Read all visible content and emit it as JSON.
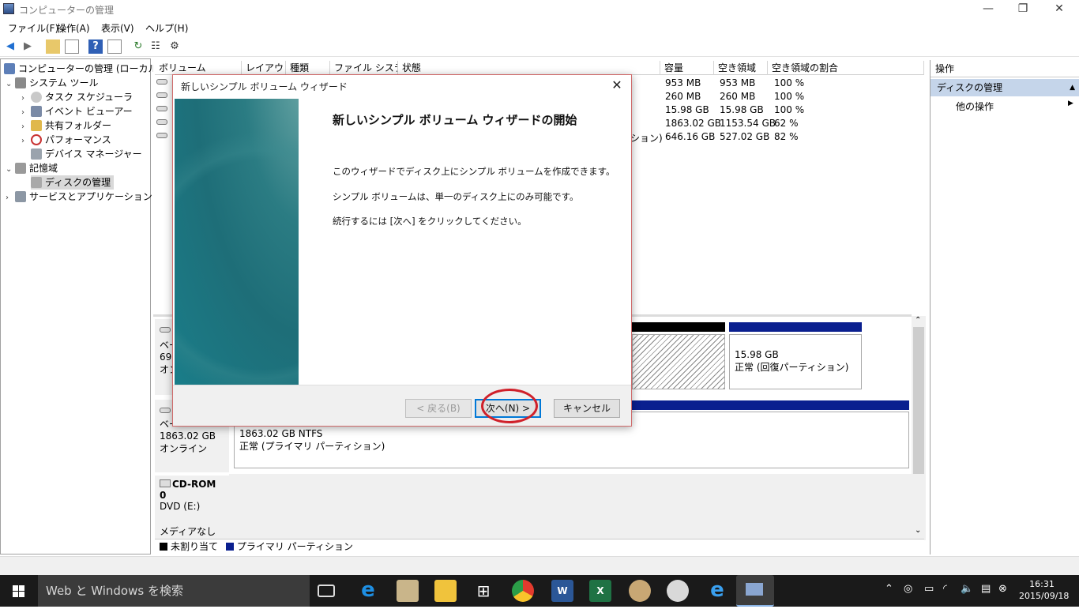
{
  "window": {
    "title": "コンピューターの管理"
  },
  "menu": [
    "ファイル(F)",
    "操作(A)",
    "表示(V)",
    "ヘルプ(H)"
  ],
  "tree": {
    "root": "コンピューターの管理 (ローカル)",
    "items": [
      {
        "label": "システム ツール"
      },
      {
        "label": "タスク スケジューラ"
      },
      {
        "label": "イベント ビューアー"
      },
      {
        "label": "共有フォルダー"
      },
      {
        "label": "パフォーマンス"
      },
      {
        "label": "デバイス マネージャー"
      },
      {
        "label": "記憶域"
      },
      {
        "label": "ディスクの管理"
      },
      {
        "label": "サービスとアプリケーション"
      }
    ]
  },
  "list": {
    "columns": [
      "ボリューム",
      "レイアウト",
      "種類",
      "ファイル システム",
      "状態",
      "容量",
      "空き領域",
      "空き領域の割合"
    ],
    "rows": [
      {
        "cap": "953 MB",
        "free": "953 MB",
        "pct": "100 %"
      },
      {
        "cap": "260 MB",
        "free": "260 MB",
        "pct": "100 %"
      },
      {
        "cap": "15.98 GB",
        "free": "15.98 GB",
        "pct": "100 %"
      },
      {
        "cap": "1863.02 GB",
        "free": "1153.54 GB",
        "pct": "62 %"
      },
      {
        "cap": "646.16 GB",
        "free": "527.02 GB",
        "pct": "82 %",
        "status_tail": "ション)"
      }
    ]
  },
  "graph": {
    "disk0_label_lines": [
      "ベー",
      "698",
      "オン"
    ],
    "disk1": {
      "label": "ベー",
      "size": "1863.02 GB",
      "state": "オンライン",
      "part_size": "1863.02 GB NTFS",
      "part_state": "正常 (プライマリ パーティション)"
    },
    "recovery": {
      "size": "15.98 GB",
      "state": "正常 (回復パーティション)"
    },
    "cdrom": {
      "name": "CD-ROM 0",
      "drive": "DVD (E:)",
      "media": "メディアなし"
    }
  },
  "legend": {
    "unallocated": "未割り当て",
    "primary": "プライマリ パーティション"
  },
  "actions": {
    "header": "操作",
    "section": "ディスクの管理",
    "item": "他の操作"
  },
  "dialog": {
    "title": "新しいシンプル ボリューム ウィザード",
    "heading": "新しいシンプル ボリューム ウィザードの開始",
    "line1": "このウィザードでディスク上にシンプル ボリュームを作成できます。",
    "line2": "シンプル ボリュームは、単一のディスク上にのみ可能です。",
    "line3": "続行するには [次へ] をクリックしてください。",
    "back": "< 戻る(B)",
    "next": "次へ(N) >",
    "cancel": "キャンセル"
  },
  "taskbar": {
    "search_placeholder": "Web と Windows を検索",
    "time": "16:31",
    "date": "2015/09/18"
  },
  "colors": {
    "accent": "#0078d7",
    "primary_partition": "#0a1f8f",
    "annotation": "#d0202a"
  }
}
